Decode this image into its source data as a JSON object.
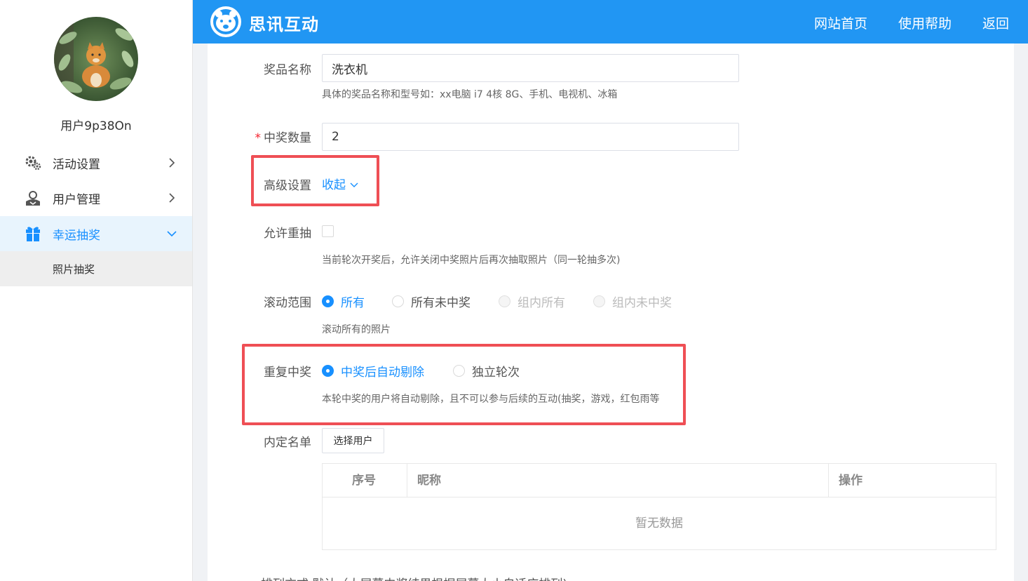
{
  "sidebar": {
    "username": "用户9p38On",
    "nav": [
      {
        "label": "活动设置",
        "icon": "gear-icon"
      },
      {
        "label": "用户管理",
        "icon": "user-icon"
      },
      {
        "label": "幸运抽奖",
        "icon": "gift-icon"
      }
    ],
    "sub_item": "照片抽奖"
  },
  "header": {
    "brand": "思讯互动",
    "links": [
      "网站首页",
      "使用帮助",
      "返回"
    ]
  },
  "form": {
    "prize_name": {
      "label": "奖品名称",
      "value": "洗衣机",
      "hint": "具体的奖品名称和型号如：xx电脑 i7 4核 8G、手机、电视机、冰箱"
    },
    "winner_count": {
      "label": "中奖数量",
      "required": "*",
      "value": "2"
    },
    "advanced": {
      "label": "高级设置",
      "toggle": "收起"
    },
    "allow_redraw": {
      "label": "允许重抽",
      "hint": "当前轮次开奖后，允许关闭中奖照片后再次抽取照片（同一轮抽多次)"
    },
    "scroll_range": {
      "label": "滚动范围",
      "options": [
        "所有",
        "所有未中奖",
        "组内所有",
        "组内未中奖"
      ],
      "selected": "所有",
      "hint": "滚动所有的照片"
    },
    "repeat_win": {
      "label": "重复中奖",
      "options": [
        "中奖后自动剔除",
        "独立轮次"
      ],
      "selected": "中奖后自动剔除",
      "hint": "本轮中奖的用户将自动剔除，且不可以参与后续的互动(抽奖，游戏，红包雨等"
    },
    "fixed_list": {
      "label": "内定名单",
      "button": "选择用户",
      "columns": [
        "序号",
        "昵称",
        "操作"
      ],
      "empty_text": "暂无数据"
    },
    "cutoff_text": "排列方式  默认（大屏幕中奖结果根据屏幕大小自适应排列)"
  },
  "colors": {
    "header": "#2196f3",
    "accent": "#1890ff",
    "highlight": "#ef4f55"
  }
}
